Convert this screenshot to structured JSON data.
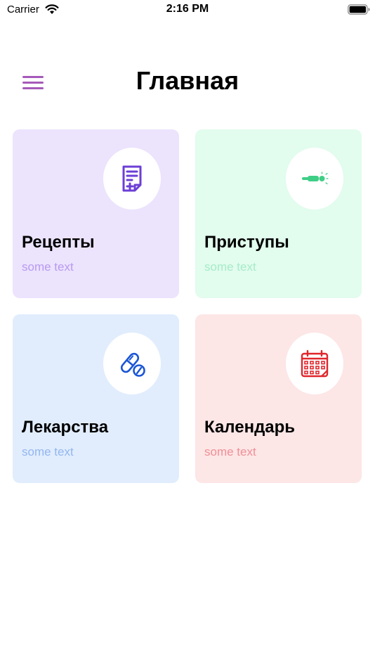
{
  "status_bar": {
    "carrier": "Carrier",
    "time": "2:16 PM",
    "wifi_icon": "wifi-icon",
    "battery_icon": "battery-icon"
  },
  "header": {
    "title": "Главная",
    "menu_icon": "hamburger-menu-icon",
    "menu_color": "#a55ab9"
  },
  "cards": [
    {
      "id": "recipes",
      "title": "Рецепты",
      "subtitle": "some text",
      "icon": "prescription-document-icon",
      "background": "#ece3fd",
      "accent": "#6c3fd6",
      "subtitle_color": "#b79af0"
    },
    {
      "id": "attacks",
      "title": "Приступы",
      "subtitle": "some text",
      "icon": "lying-person-icon",
      "background": "#e2fcee",
      "accent": "#3fce86",
      "subtitle_color": "#a5ecc8"
    },
    {
      "id": "medicines",
      "title": "Лекарства",
      "subtitle": "some text",
      "icon": "pills-icon",
      "background": "#e1edfd",
      "accent": "#1a55d6",
      "subtitle_color": "#93b6f0"
    },
    {
      "id": "calendar",
      "title": "Календарь",
      "subtitle": "some text",
      "icon": "calendar-icon",
      "background": "#fde6e6",
      "accent": "#e0262c",
      "subtitle_color": "#f08f96"
    }
  ]
}
